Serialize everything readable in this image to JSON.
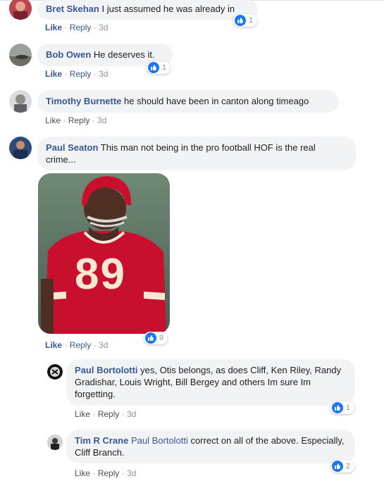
{
  "comments": [
    {
      "author": "Bret Skehan",
      "text": "I just assumed he was already in",
      "like": "Like",
      "reply": "Reply",
      "sep": "·",
      "time": "3d",
      "reactions": "1"
    },
    {
      "author": "Bob Owen",
      "text": "He deserves it.",
      "like": "Like",
      "reply": "Reply",
      "sep": "·",
      "time": "3d",
      "reactions": "1"
    },
    {
      "author": "Timothy Burnette",
      "text": "he should have been in canton along timeago",
      "like": "Like",
      "reply": "Reply",
      "sep": "·",
      "time": "3d"
    },
    {
      "author": "Paul Seaton",
      "text": "This man not being in the pro football HOF is the real crime...",
      "like": "Like",
      "reply": "Reply",
      "sep": "·",
      "time": "3d",
      "reactions": "9",
      "photo": {
        "jersey_number": "89",
        "jersey_color": "#c8102e",
        "helmet_color": "#c8102e"
      }
    }
  ],
  "replies": [
    {
      "author": "Paul Bortolotti",
      "text": "yes, Otis belongs, as does Cliff, Ken Riley, Randy Gradishar, Louis Wright, Bill Bergey and others Im sure Im forgetting.",
      "like": "Like",
      "reply": "Reply",
      "sep": "·",
      "time": "3d",
      "reactions": "1"
    },
    {
      "author": "Tim R Crane",
      "mention": "Paul Bortolotti",
      "text": "correct on all of the above. Especially, Cliff Branch.",
      "like": "Like",
      "reply": "Reply",
      "sep": "·",
      "time": "3d",
      "reactions": "2"
    }
  ],
  "colors": {
    "link": "#385898",
    "bubble": "#f2f3f5",
    "meta": "#90949c",
    "like_blue": "#1877f2"
  },
  "icons": [
    "thumbs-up-icon"
  ]
}
